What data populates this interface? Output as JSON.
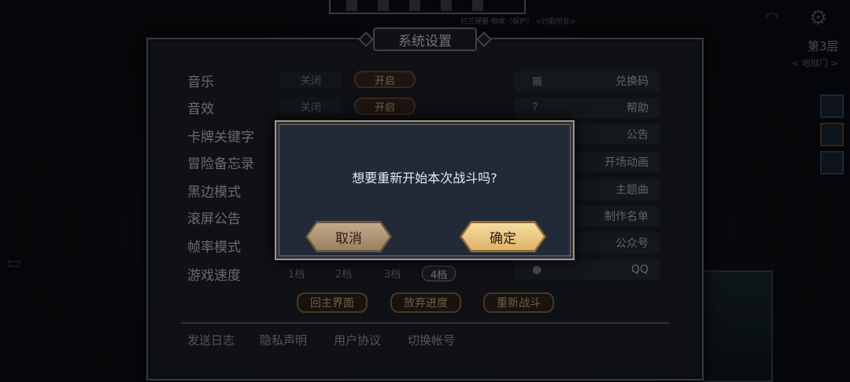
{
  "background": {
    "floor_label": "第3层",
    "floor_sub": "< 地狱门 >",
    "top_info": "已三得要·物收（保护）   <已取所在>"
  },
  "settings": {
    "title": "系统设置",
    "rows": [
      {
        "label": "音乐",
        "off": "关闭",
        "on": "开启"
      },
      {
        "label": "音效",
        "off": "关闭",
        "on": "开启"
      },
      {
        "label": "卡牌关键字"
      },
      {
        "label": "冒险备忘录"
      },
      {
        "label": "黑边模式"
      },
      {
        "label": "滚屏公告"
      },
      {
        "label": "帧率模式"
      },
      {
        "label": "游戏速度"
      }
    ],
    "speed_options": [
      "1档",
      "2档",
      "3档",
      "4档"
    ],
    "speed_selected": "4档",
    "side_buttons": [
      {
        "label": "兑换码",
        "icon": "qr-icon"
      },
      {
        "label": "帮助",
        "icon": "help-icon"
      },
      {
        "label": "公告",
        "icon": "announcement-icon"
      },
      {
        "label": "开场动画",
        "icon": "video-icon"
      },
      {
        "label": "主题曲",
        "icon": "music-icon"
      },
      {
        "label": "制作名单",
        "icon": "credits-icon"
      },
      {
        "label": "公众号",
        "icon": "wechat-icon"
      },
      {
        "label": "QQ",
        "icon": "qq-icon"
      }
    ],
    "action_buttons": [
      "回主界面",
      "放弃进度",
      "重新战斗"
    ],
    "footer_links": [
      "发送日志",
      "隐私声明",
      "用户协议",
      "切换帐号"
    ]
  },
  "dialog": {
    "message": "想要重新开始本次战斗吗?",
    "cancel_label": "取消",
    "confirm_label": "确定"
  },
  "colors": {
    "dialog_bg": "#222a38",
    "confirm_gold": "#e0b468",
    "cancel_tan": "#9b8062"
  }
}
